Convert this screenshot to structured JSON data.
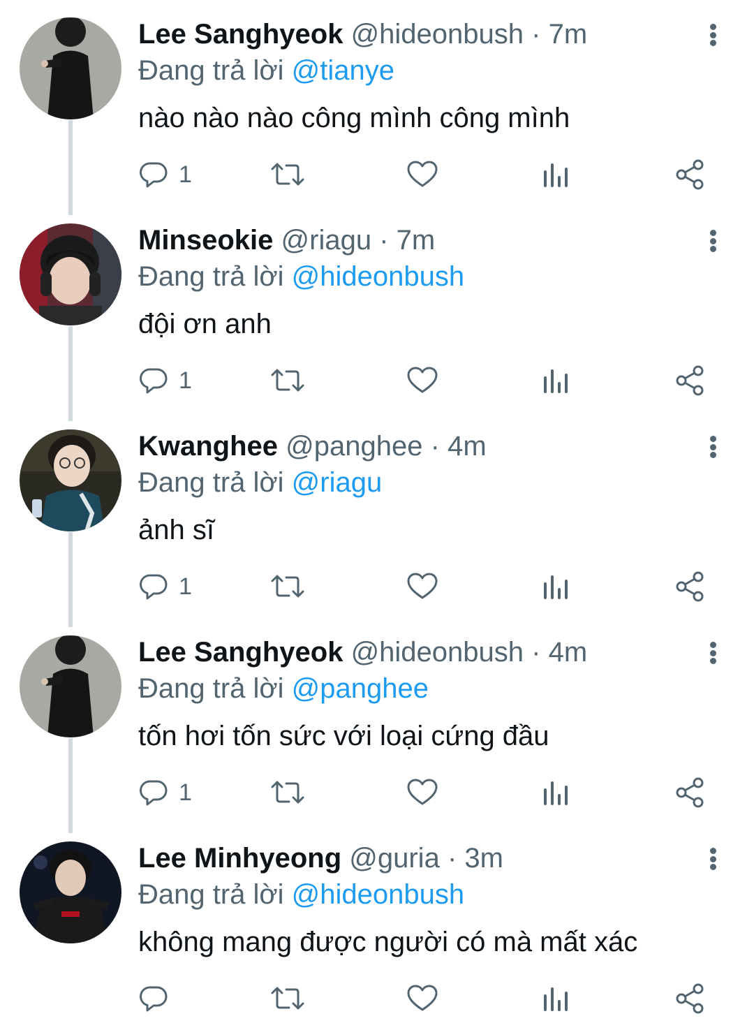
{
  "reply_prefix": "Đang trả lời",
  "tweets": [
    {
      "name": "Lee Sanghyeok",
      "handle": "@hideonbush",
      "separator": "·",
      "time": "7m",
      "reply_to": "@tianye",
      "text": "nào nào nào công mình công mình",
      "reply_count": "1"
    },
    {
      "name": "Minseokie",
      "handle": "@riagu",
      "separator": "·",
      "time": "7m",
      "reply_to": "@hideonbush",
      "text": "đội ơn anh",
      "reply_count": "1"
    },
    {
      "name": "Kwanghee",
      "handle": "@panghee",
      "separator": "·",
      "time": "4m",
      "reply_to": "@riagu",
      "text": "ảnh sĩ",
      "reply_count": "1"
    },
    {
      "name": "Lee Sanghyeok",
      "handle": "@hideonbush",
      "separator": "·",
      "time": "4m",
      "reply_to": "@panghee",
      "text": "tốn hơi tốn sức với loại cứng đầu",
      "reply_count": "1"
    },
    {
      "name": "Lee Minhyeong",
      "handle": "@guria",
      "separator": "·",
      "time": "3m",
      "reply_to": "@hideonbush",
      "text": "không mang được người có mà mất xác",
      "reply_count": ""
    }
  ],
  "colors": {
    "text_primary": "#0f1419",
    "text_secondary": "#536471",
    "mention": "#1d9bf0",
    "thread_line": "#cfd9de"
  },
  "icons": [
    "reply-icon",
    "retweet-icon",
    "like-icon",
    "analytics-icon",
    "share-icon",
    "more-options-icon"
  ]
}
